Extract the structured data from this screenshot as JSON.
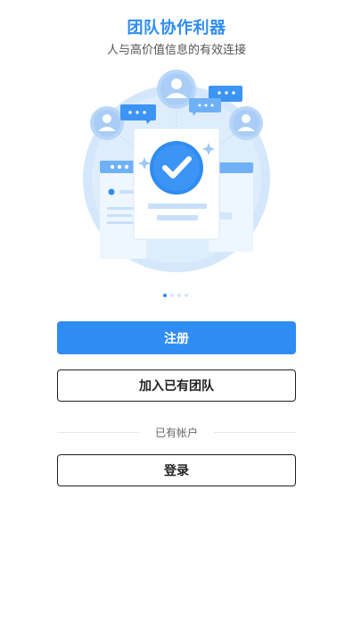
{
  "header": {
    "title": "团队协作利器",
    "subtitle": "人与高价值信息的有效连接"
  },
  "illustration": {
    "name": "team-collaboration-illustration",
    "icon": "check-icon",
    "colors": {
      "accent": "#2F8CF2",
      "light": "#C9E0FA"
    }
  },
  "carousel": {
    "pages": 4,
    "active_index": 0
  },
  "actions": {
    "register_label": "注册",
    "join_team_label": "加入已有团队",
    "divider_label": "已有帐户",
    "login_label": "登录"
  },
  "theme": {
    "accent": "#2F8CF2",
    "text": "#222222"
  }
}
